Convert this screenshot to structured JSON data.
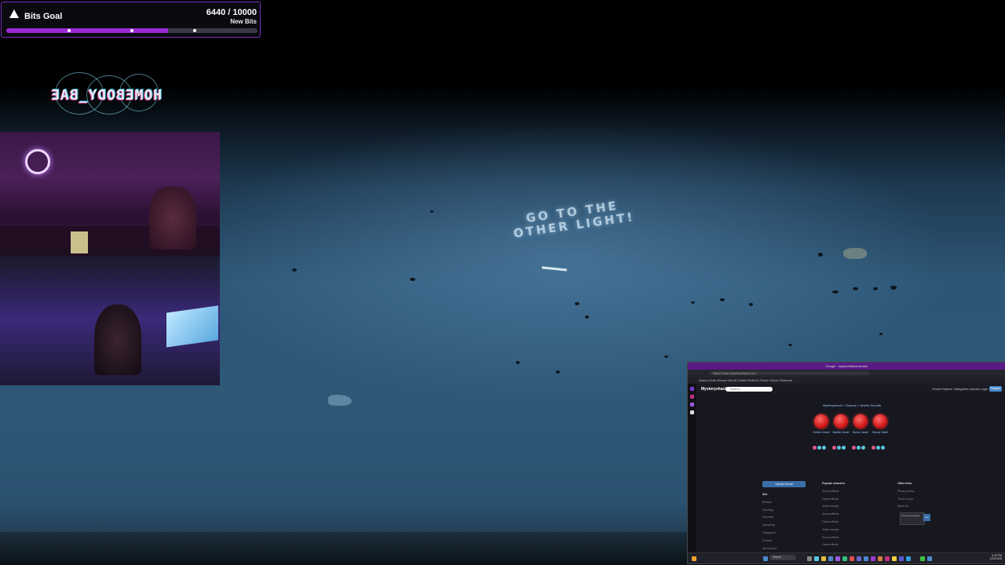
{
  "bits_goal": {
    "title": "Bits Goal",
    "count": "6440 / 10000",
    "subtitle": "New Bits",
    "progress": 0.644,
    "icon": "triangle-icon",
    "colors": {
      "fill": "#9b2bd6",
      "border": "#7a2fc0"
    }
  },
  "logo": {
    "text": "HOMEBODY_BAE"
  },
  "scene": {
    "floor_message_line1": "GO TO THE",
    "floor_message_line2": "OTHER LIGHT!"
  },
  "browser": {
    "window_title": "Google · mystcraftsavedsnails",
    "url": "https://www.mysteryshack.com",
    "bookmarks": "Mystery Brush   Moneys Oak   All Collabs   Reddit   Art Fetcher   Orphan   Slideshow",
    "brand": "Mysteryshack",
    "search_placeholder": "Search",
    "nav_links": "Home  Explore  Categories  Upload  Login",
    "nav_button": "Register",
    "breadcrumb": "Mysteryshack > Sounds > Jewels Sounds",
    "items": [
      {
        "name": "Golden Jewel"
      },
      {
        "name": "Bubble Jewel"
      },
      {
        "name": "Bonus Jewel"
      },
      {
        "name": "Sound Jewel"
      }
    ],
    "upload_label": "Upload Sound",
    "footer_col1": {
      "title": "Site",
      "links": [
        "Browse",
        "Trending",
        "Favorites",
        "Upcoming",
        "Categories",
        "Contact",
        "My Account"
      ]
    },
    "footer_col2": {
      "title": "Popular searches",
      "links": [
        "Sound effects",
        "Game effects",
        "Jewel sounds",
        "Sound effects",
        "Game effects",
        "Jewel sounds",
        "Sound effects",
        "Game effects"
      ]
    },
    "footer_col3": {
      "title": "Other links",
      "links": [
        "Privacy policy",
        "Terms of use",
        "About us"
      ]
    },
    "mini_dialog": "Change language",
    "mini_button": "Go",
    "taskbar_search": "Search",
    "taskbar_time": "3:40 PM",
    "taskbar_date": "1/23/2025"
  }
}
